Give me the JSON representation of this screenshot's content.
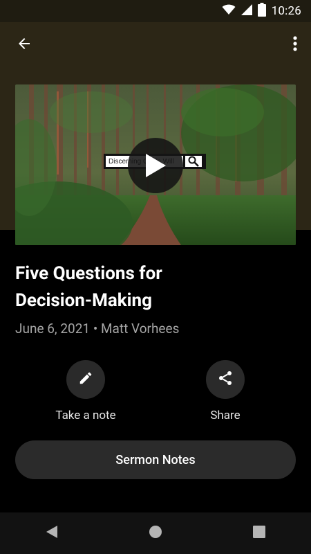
{
  "status_bar": {
    "time": "10:26",
    "icons": [
      "wifi-icon",
      "cell-signal-icon",
      "battery-icon"
    ]
  },
  "toolbar": {
    "back_icon": "arrow-back-icon",
    "menu_icon": "more-vert-icon"
  },
  "video": {
    "search_text": "Discerning God's Will",
    "play_icon": "play-icon"
  },
  "sermon": {
    "title_line1": "Five Questions for",
    "title_line2": "Decision-Making",
    "date": "June 6, 2021",
    "separator": "•",
    "speaker": "Matt Vorhees"
  },
  "actions": {
    "take_note_label": "Take a note",
    "share_label": "Share"
  },
  "sermon_notes_label": "Sermon Notes",
  "colors": {
    "header_band": "#2c2616",
    "background": "#000000",
    "button_bg": "#2b2b2b",
    "meta_text": "#a5a5a5"
  }
}
